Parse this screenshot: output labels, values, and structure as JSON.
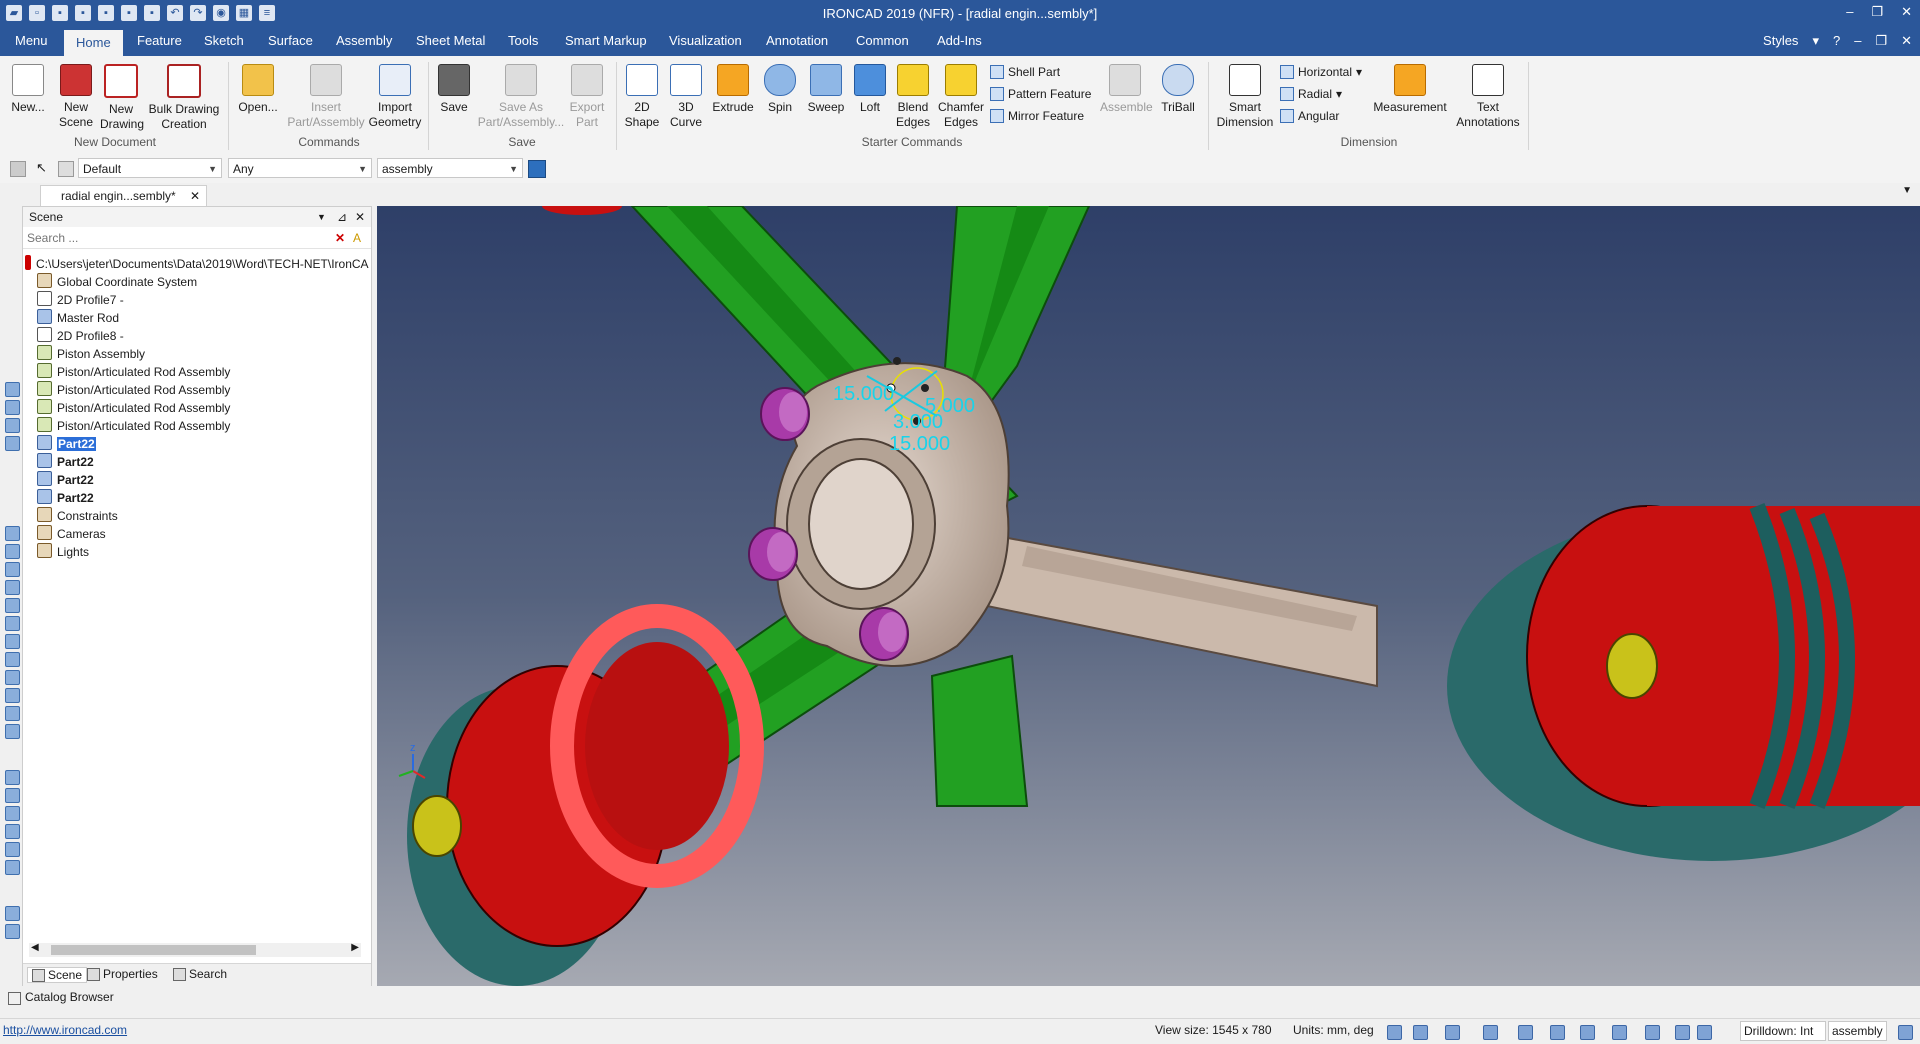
{
  "window": {
    "title": "IRONCAD 2019 (NFR) - [radial engin...sembly*]"
  },
  "menu": {
    "tabs": [
      "Menu",
      "Home",
      "Feature",
      "Sketch",
      "Surface",
      "Assembly",
      "Sheet Metal",
      "Tools",
      "Smart Markup",
      "Visualization",
      "Annotation",
      "Common",
      "Add-Ins"
    ],
    "active": "Home",
    "styles_label": "Styles"
  },
  "ribbon": {
    "new_document": {
      "label": "New Document",
      "new": "New...",
      "new_scene": "New\nScene",
      "new_drawing": "New\nDrawing",
      "bulk": "Bulk Drawing\nCreation"
    },
    "commands": {
      "label": "Commands",
      "open": "Open...",
      "insert": "Insert\nPart/Assembly",
      "import": "Import\nGeometry"
    },
    "save": {
      "label": "Save",
      "save": "Save",
      "save_as": "Save As\nPart/Assembly...",
      "export": "Export\nPart"
    },
    "starter": {
      "label": "Starter Commands",
      "shape2d": "2D\nShape",
      "curve3d": "3D\nCurve",
      "extrude": "Extrude",
      "spin": "Spin",
      "sweep": "Sweep",
      "loft": "Loft",
      "blend": "Blend\nEdges",
      "chamfer": "Chamfer\nEdges",
      "shell": "Shell Part",
      "pattern": "Pattern Feature",
      "mirror": "Mirror Feature",
      "assemble": "Assemble",
      "triball": "TriBall"
    },
    "dimension": {
      "label": "Dimension",
      "smart": "Smart\nDimension",
      "horizontal": "Horizontal",
      "radial": "Radial",
      "angular": "Angular",
      "measurement": "Measurement",
      "text": "Text\nAnnotations"
    }
  },
  "toolbar2": {
    "style": "Default",
    "filter": "Any",
    "level": "assembly"
  },
  "document_tab": {
    "label": "radial engin...sembly*"
  },
  "scene": {
    "title": "Scene",
    "search_placeholder": "Search ...",
    "items": [
      {
        "label": "C:\\Users\\jeter\\Documents\\Data\\2019\\Word\\TECH-NET\\IronCA",
        "kind": "root"
      },
      {
        "label": "Global Coordinate System",
        "kind": "misc"
      },
      {
        "label": "2D Profile7 -",
        "kind": "prof"
      },
      {
        "label": "Master Rod",
        "kind": "part"
      },
      {
        "label": "2D Profile8 -",
        "kind": "prof"
      },
      {
        "label": "Piston Assembly",
        "kind": "asm"
      },
      {
        "label": "Piston/Articulated Rod Assembly",
        "kind": "asm"
      },
      {
        "label": "Piston/Articulated Rod Assembly",
        "kind": "asm"
      },
      {
        "label": "Piston/Articulated Rod Assembly",
        "kind": "asm"
      },
      {
        "label": "Piston/Articulated Rod Assembly",
        "kind": "asm"
      },
      {
        "label": "Part22",
        "kind": "part",
        "state": "selected"
      },
      {
        "label": "Part22",
        "kind": "part",
        "state": "bold"
      },
      {
        "label": "Part22",
        "kind": "part",
        "state": "bold"
      },
      {
        "label": "Part22",
        "kind": "part",
        "state": "bold"
      },
      {
        "label": "Constraints",
        "kind": "misc"
      },
      {
        "label": "Cameras",
        "kind": "misc"
      },
      {
        "label": "Lights",
        "kind": "misc"
      }
    ],
    "tabs": {
      "scene": "Scene",
      "properties": "Properties",
      "search": "Search"
    }
  },
  "viewport": {
    "dimensions": [
      "15.000",
      "15.000",
      "5.000",
      "3.000"
    ],
    "triad_axis": "z"
  },
  "catalog": {
    "label": "Catalog Browser"
  },
  "status": {
    "url": "http://www.ironcad.com",
    "view_size": "View size: 1545 x 780",
    "units": "Units: mm, deg",
    "drilldown": "Drilldown: Int",
    "level": "assembly"
  },
  "colors": {
    "brand": "#2b579a",
    "selection": "#2b6ed8",
    "part_green": "#1fa01f",
    "piston_red": "#d01010",
    "rod_tan": "#cdbcae",
    "pin_magenta": "#b040b0"
  }
}
